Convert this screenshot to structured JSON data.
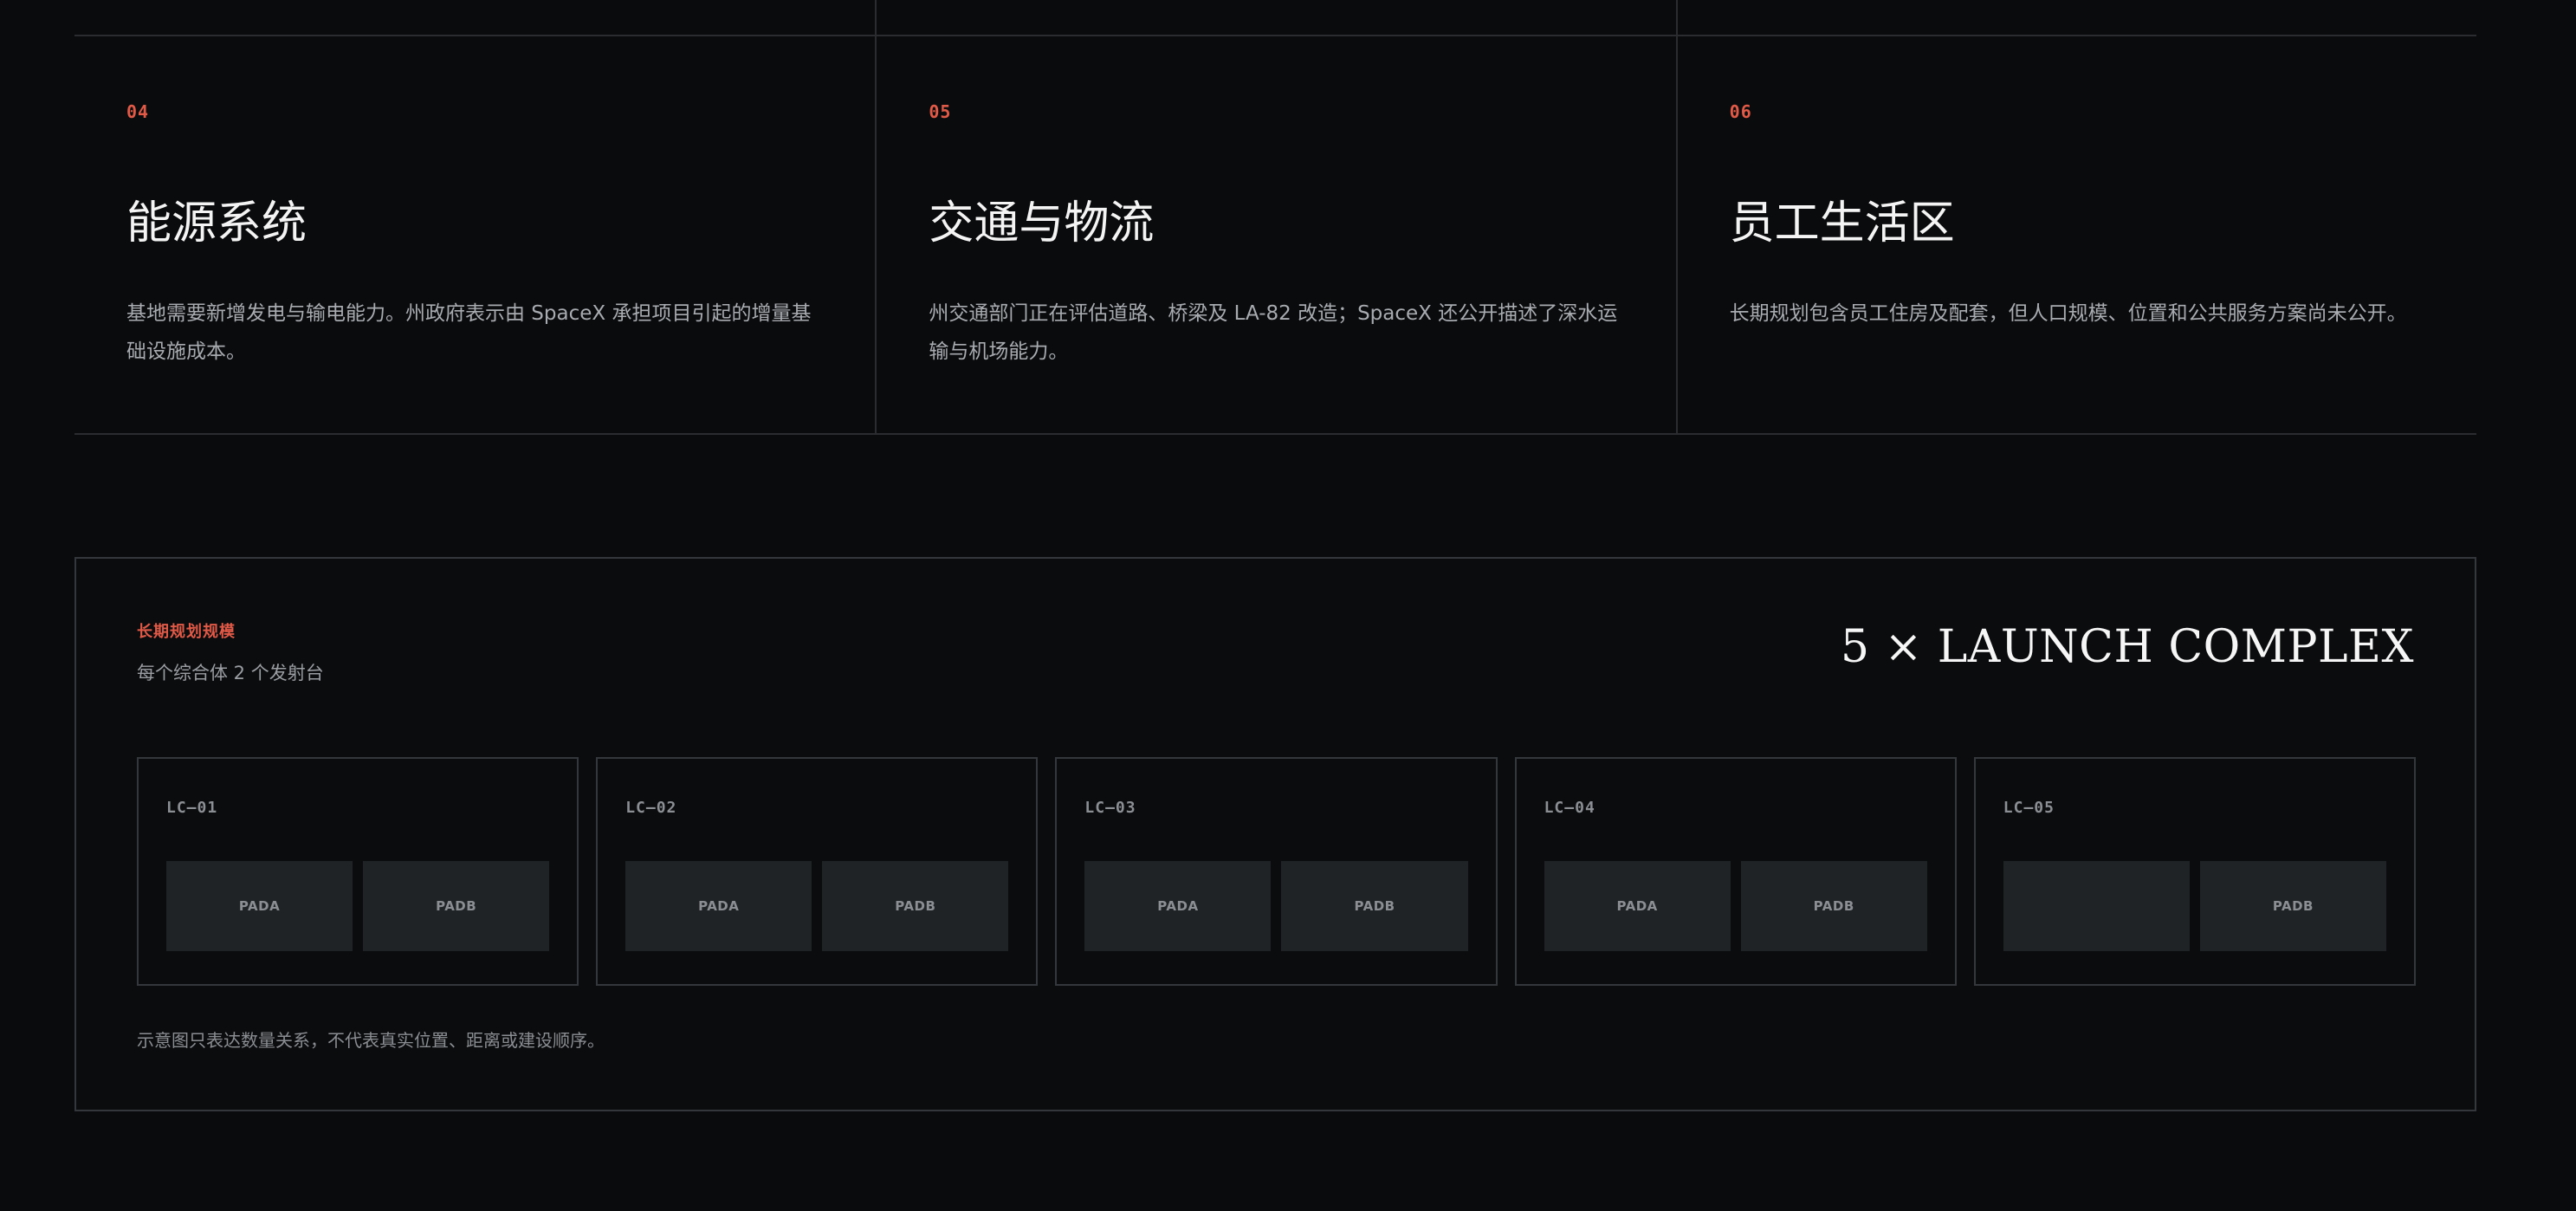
{
  "cards": [
    {
      "number": "04",
      "title": "能源系统",
      "description": "基地需要新增发电与输电能力。州政府表示由 SpaceX 承担项目引起的增量基础设施成本。"
    },
    {
      "number": "05",
      "title": "交通与物流",
      "description": "州交通部门正在评估道路、桥梁及 LA-82 改造；SpaceX 还公开描述了深水运输与机场能力。"
    },
    {
      "number": "06",
      "title": "员工生活区",
      "description": "长期规划包含员工住房及配套，但人口规模、位置和公共服务方案尚未公开。"
    }
  ],
  "panel": {
    "eyebrow": "长期规划规模",
    "subtitle": "每个综合体 2 个发射台",
    "headline": "5 × LAUNCH COMPLEX",
    "complexes": [
      {
        "label": "LC—01",
        "pads": [
          "PADA",
          "PADB"
        ]
      },
      {
        "label": "LC—02",
        "pads": [
          "PADA",
          "PADB"
        ]
      },
      {
        "label": "LC—03",
        "pads": [
          "PADA",
          "PADB"
        ]
      },
      {
        "label": "LC—04",
        "pads": [
          "PADA",
          "PADB"
        ]
      },
      {
        "label": "LC—05",
        "pads": [
          "",
          "PADB"
        ]
      }
    ],
    "note": "示意图只表达数量关系，不代表真实位置、距离或建设顺序。"
  }
}
